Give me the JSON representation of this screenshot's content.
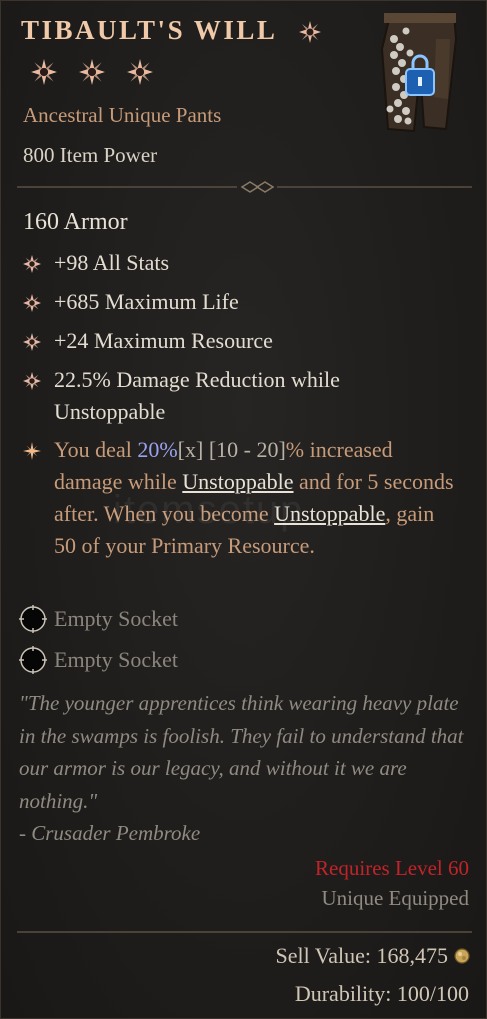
{
  "item": {
    "name": "TIBAULT'S WILL",
    "type": "Ancestral Unique Pants",
    "item_power": "800 Item Power",
    "armor": "160 Armor"
  },
  "affixes": [
    "+98 All Stats",
    "+685 Maximum Life",
    "+24 Maximum Resource",
    "22.5% Damage Reduction while Unstoppable"
  ],
  "unique_power": {
    "p1": "You deal ",
    "pct": "20%",
    "x": "[x] ",
    "range": "[10 - 20]",
    "p2": "% increased damage while ",
    "kw1": "Unstoppable",
    "p3": " and for 5 seconds after. When you become ",
    "kw2": "Unstoppable",
    "p4": ", gain 50 of your Primary Resource."
  },
  "sockets": [
    "Empty Socket",
    "Empty Socket"
  ],
  "flavor": {
    "quote": "\"The younger apprentices think wearing heavy plate in the swamps is foolish. They fail to understand that our armor is our legacy, and without it we are nothing.\"",
    "author": "- Crusader Pembroke"
  },
  "requirements": {
    "level": "Requires Level 60",
    "equip": "Unique Equipped"
  },
  "footer": {
    "sell_value": "Sell Value: 168,475",
    "durability": "Durability: 100/100"
  },
  "watermark": "itemsetup",
  "colors": {
    "title": "#f0c9a8",
    "type": "#c79b79",
    "unique_text": "#c79b79",
    "percent": "#9aa3f0",
    "requirement": "#c0242a",
    "muted": "#8f8a82"
  },
  "icons": {
    "rarity": "sparkle-star-icon",
    "lock": "lock-icon",
    "affix_bullet": "star-bullet-icon",
    "unique_bullet": "unique-star-icon",
    "socket": "socket-ring-icon",
    "coin": "gold-coin-icon"
  }
}
